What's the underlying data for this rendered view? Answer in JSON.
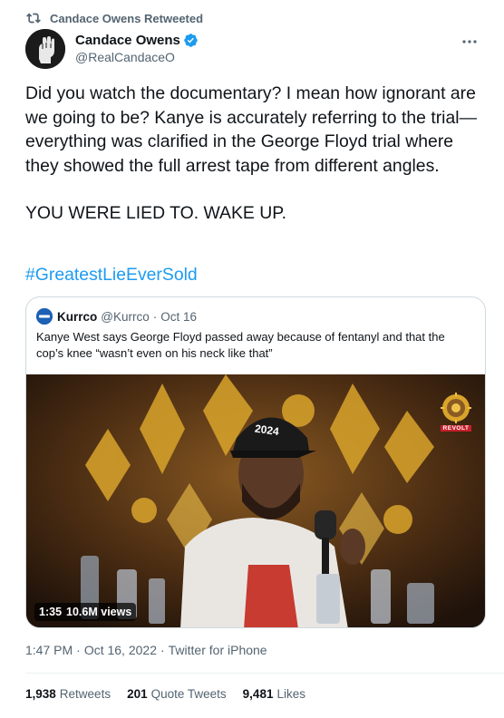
{
  "retweet": {
    "label": "Candace Owens Retweeted",
    "icon": "retweet-icon"
  },
  "author": {
    "display_name": "Candace Owens",
    "handle": "@RealCandaceO",
    "verified_icon": "verified-badge-icon",
    "avatar_icon": "raised-fist-avatar"
  },
  "more_icon": "more-dots-icon",
  "tweet": {
    "paragraph_1": "Did you watch the documentary? I mean how ignorant are we going to be? Kanye is accurately referring to the trial— everything was clarified in the George Floyd trial where they showed the full arrest tape from different angles.",
    "paragraph_2": "YOU WERE LIED TO. WAKE UP.",
    "hashtag": "#GreatestLieEverSold"
  },
  "quoted_tweet": {
    "name": "Kurrco",
    "handle": "@Kurrco",
    "separator": "·",
    "date": "Oct 16",
    "text": "Kanye West says George Floyd passed away because of fentanyl and that the cop’s knee “wasn’t even on his neck like that”",
    "video": {
      "duration": "1:35",
      "views": "10.6M views",
      "watermark_text": "REVOLT",
      "cap_text": "2024"
    }
  },
  "meta": {
    "time": "1:47 PM",
    "separator": "·",
    "date": "Oct 16, 2022",
    "client": "Twitter for iPhone"
  },
  "stats": {
    "retweets_count": "1,938",
    "retweets_label": "Retweets",
    "quotes_count": "201",
    "quotes_label": "Quote Tweets",
    "likes_count": "9,481",
    "likes_label": "Likes"
  },
  "colors": {
    "link": "#1d9bf0",
    "secondary_text": "#536471",
    "primary_text": "#0f1419",
    "border": "#cfd9de"
  }
}
